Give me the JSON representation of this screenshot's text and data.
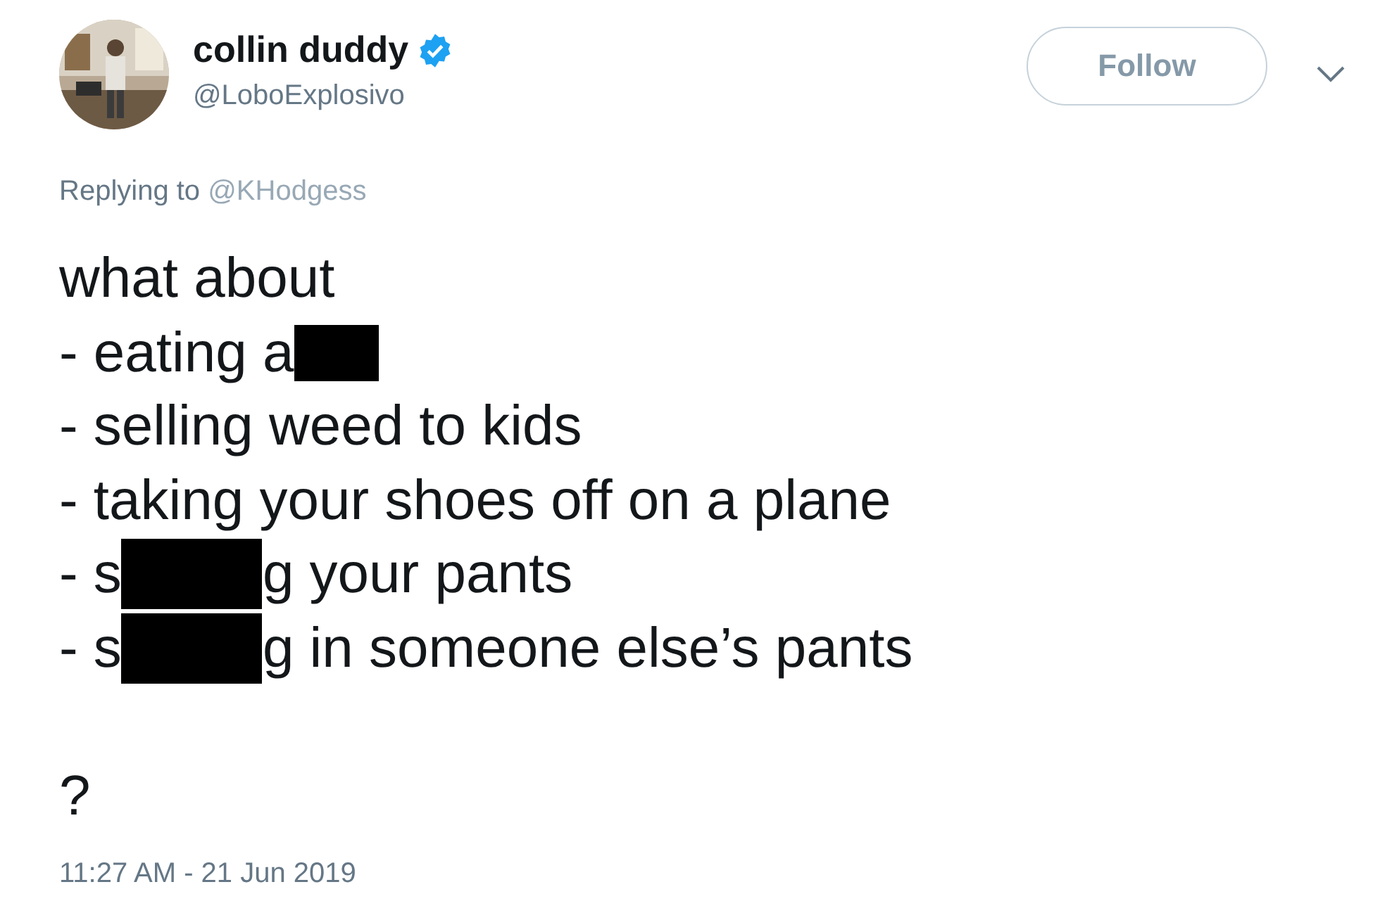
{
  "author": {
    "name": "collin duddy",
    "verified": true,
    "handle": "@LoboExplosivo"
  },
  "follow_button": {
    "label": "Follow"
  },
  "reply": {
    "prefix": "Replying to",
    "mention": "@KHodgess"
  },
  "tweet_lines": [
    [
      {
        "kind": "text",
        "text": "what about"
      }
    ],
    [
      {
        "kind": "text",
        "text": "- eating a"
      },
      {
        "kind": "redaction"
      }
    ],
    [
      {
        "kind": "text",
        "text": "- selling weed to kids"
      }
    ],
    [
      {
        "kind": "text",
        "text": "- taking your shoes off on a plane"
      }
    ],
    [
      {
        "kind": "text",
        "text": "- s"
      },
      {
        "kind": "redaction"
      },
      {
        "kind": "text",
        "text": "g your pants"
      }
    ],
    [
      {
        "kind": "text",
        "text": "- s"
      },
      {
        "kind": "redaction"
      },
      {
        "kind": "text",
        "text": "g in someone else’s pants"
      }
    ],
    [
      {
        "kind": "text",
        "text": "?",
        "spaced": true
      }
    ]
  ],
  "timestamp": "11:27 AM - 21 Jun 2019"
}
